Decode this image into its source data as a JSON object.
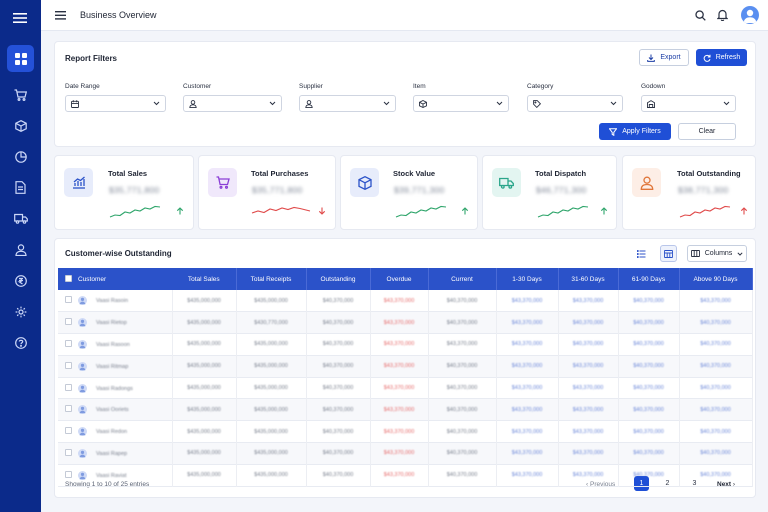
{
  "header": {
    "title": "Business Overview"
  },
  "sidebar": {
    "items": [
      {
        "name": "dashboard-icon",
        "active": true
      },
      {
        "name": "cart-icon"
      },
      {
        "name": "box-icon"
      },
      {
        "name": "pie-chart-icon"
      },
      {
        "name": "document-icon"
      },
      {
        "name": "truck-icon"
      },
      {
        "name": "user-icon"
      },
      {
        "name": "rupee-icon"
      },
      {
        "name": "gear-icon"
      },
      {
        "name": "help-icon"
      }
    ]
  },
  "filters": {
    "title": "Report Filters",
    "export_label": "Export",
    "refresh_label": "Refresh",
    "fields": [
      {
        "label": "Date Range",
        "icon": "calendar-icon"
      },
      {
        "label": "Customer",
        "icon": "user-icon"
      },
      {
        "label": "Supplier",
        "icon": "user-icon"
      },
      {
        "label": "Item",
        "icon": "box-icon"
      },
      {
        "label": "Category",
        "icon": "tag-icon"
      },
      {
        "label": "Godown",
        "icon": "warehouse-icon"
      }
    ],
    "apply_label": "Apply Filters",
    "clear_label": "Clear"
  },
  "stats": [
    {
      "title": "Total Sales",
      "value": "$35,771,800",
      "trend": "up",
      "color": "#2fa56b",
      "icon": "bar-chart-icon",
      "bg": "#e7ecfb",
      "fg": "#2b52c9"
    },
    {
      "title": "Total Purchases",
      "value": "$35,771,800",
      "trend": "down",
      "color": "#e04a4a",
      "icon": "cart-icon",
      "bg": "#f0e8fb",
      "fg": "#8b3fd6"
    },
    {
      "title": "Stock Value",
      "value": "$39,771,300",
      "trend": "up",
      "color": "#2fa56b",
      "icon": "box-icon",
      "bg": "#e7ecfb",
      "fg": "#2b52c9"
    },
    {
      "title": "Total Dispatch",
      "value": "$46,771,300",
      "trend": "up",
      "color": "#2fa56b",
      "icon": "truck-icon",
      "bg": "#e3f5f1",
      "fg": "#2aa58a"
    },
    {
      "title": "Total Outstanding",
      "value": "$38,771,300",
      "trend": "up",
      "color": "#e04a4a",
      "icon": "user-icon",
      "bg": "#fdeee6",
      "fg": "#e0763a"
    }
  ],
  "outstanding": {
    "title": "Customer-wise Outstanding",
    "columns_label": "Columns",
    "headers": [
      "Customer",
      "Total Sales",
      "Total Receipts",
      "Outstanding",
      "Overdue",
      "Current",
      "1-30 Days",
      "31-60 Days",
      "61-90 Days",
      "Above 90 Days"
    ],
    "rows": [
      [
        "Vaasi Rasoin",
        "$435,000,000",
        "$435,000,000",
        "$40,370,000",
        "$43,370,000",
        "$40,370,000",
        "$43,370,000",
        "$43,370,000",
        "$40,370,000",
        "$43,370,000"
      ],
      [
        "Vaasi Rietop",
        "$435,000,000",
        "$430,770,000",
        "$40,370,000",
        "$43,370,000",
        "$40,370,000",
        "$43,370,000",
        "$40,370,000",
        "$40,370,000",
        "$40,370,000"
      ],
      [
        "Vaasi Rasoon",
        "$435,000,000",
        "$435,000,000",
        "$40,370,000",
        "$43,370,000",
        "$43,370,000",
        "$43,370,000",
        "$40,370,000",
        "$40,370,000",
        "$40,370,000"
      ],
      [
        "Vaasi Ritmap",
        "$435,000,000",
        "$435,000,000",
        "$40,370,000",
        "$43,370,000",
        "$40,370,000",
        "$43,370,000",
        "$43,370,000",
        "$40,370,000",
        "$40,370,000"
      ],
      [
        "Vaasi Radongs",
        "$435,000,000",
        "$435,000,000",
        "$40,370,000",
        "$43,370,000",
        "$40,370,000",
        "$43,370,000",
        "$43,370,000",
        "$40,370,000",
        "$40,370,000"
      ],
      [
        "Vaasi Ooriets",
        "$435,000,000",
        "$435,000,000",
        "$40,370,000",
        "$43,370,000",
        "$40,370,000",
        "$43,370,000",
        "$43,370,000",
        "$40,370,000",
        "$40,370,000"
      ],
      [
        "Vaasi Redon",
        "$435,000,000",
        "$435,000,000",
        "$40,370,000",
        "$43,370,000",
        "$40,370,000",
        "$43,370,000",
        "$43,370,000",
        "$40,370,000",
        "$40,370,000"
      ],
      [
        "Vaasi Rapep",
        "$435,000,000",
        "$435,000,000",
        "$40,370,000",
        "$43,370,000",
        "$40,370,000",
        "$43,370,000",
        "$43,370,000",
        "$40,370,000",
        "$40,370,000"
      ],
      [
        "Vaasi Raviat",
        "$435,000,000",
        "$435,000,000",
        "$40,370,000",
        "$43,370,000",
        "$40,370,000",
        "$43,370,000",
        "$43,370,000",
        "$40,370,000",
        "$40,370,000"
      ]
    ],
    "entries_text": "Showing 1 to 10 of 25 entries",
    "prev_label": "Previous",
    "next_label": "Next",
    "pages": [
      "1",
      "2",
      "3"
    ],
    "current_page": "1"
  }
}
